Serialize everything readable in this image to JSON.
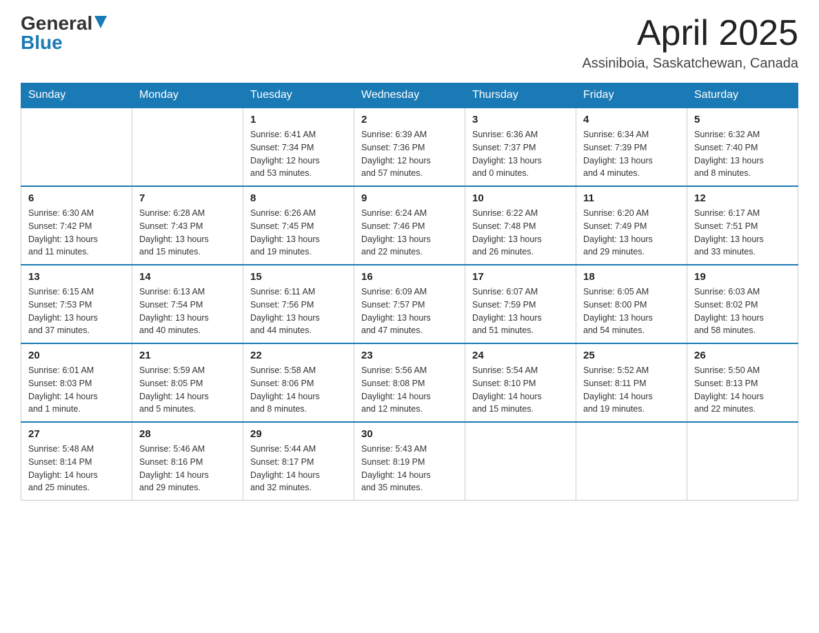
{
  "logo": {
    "general": "General",
    "blue": "Blue"
  },
  "title": "April 2025",
  "location": "Assiniboia, Saskatchewan, Canada",
  "weekdays": [
    "Sunday",
    "Monday",
    "Tuesday",
    "Wednesday",
    "Thursday",
    "Friday",
    "Saturday"
  ],
  "weeks": [
    [
      {
        "day": "",
        "info": ""
      },
      {
        "day": "",
        "info": ""
      },
      {
        "day": "1",
        "info": "Sunrise: 6:41 AM\nSunset: 7:34 PM\nDaylight: 12 hours\nand 53 minutes."
      },
      {
        "day": "2",
        "info": "Sunrise: 6:39 AM\nSunset: 7:36 PM\nDaylight: 12 hours\nand 57 minutes."
      },
      {
        "day": "3",
        "info": "Sunrise: 6:36 AM\nSunset: 7:37 PM\nDaylight: 13 hours\nand 0 minutes."
      },
      {
        "day": "4",
        "info": "Sunrise: 6:34 AM\nSunset: 7:39 PM\nDaylight: 13 hours\nand 4 minutes."
      },
      {
        "day": "5",
        "info": "Sunrise: 6:32 AM\nSunset: 7:40 PM\nDaylight: 13 hours\nand 8 minutes."
      }
    ],
    [
      {
        "day": "6",
        "info": "Sunrise: 6:30 AM\nSunset: 7:42 PM\nDaylight: 13 hours\nand 11 minutes."
      },
      {
        "day": "7",
        "info": "Sunrise: 6:28 AM\nSunset: 7:43 PM\nDaylight: 13 hours\nand 15 minutes."
      },
      {
        "day": "8",
        "info": "Sunrise: 6:26 AM\nSunset: 7:45 PM\nDaylight: 13 hours\nand 19 minutes."
      },
      {
        "day": "9",
        "info": "Sunrise: 6:24 AM\nSunset: 7:46 PM\nDaylight: 13 hours\nand 22 minutes."
      },
      {
        "day": "10",
        "info": "Sunrise: 6:22 AM\nSunset: 7:48 PM\nDaylight: 13 hours\nand 26 minutes."
      },
      {
        "day": "11",
        "info": "Sunrise: 6:20 AM\nSunset: 7:49 PM\nDaylight: 13 hours\nand 29 minutes."
      },
      {
        "day": "12",
        "info": "Sunrise: 6:17 AM\nSunset: 7:51 PM\nDaylight: 13 hours\nand 33 minutes."
      }
    ],
    [
      {
        "day": "13",
        "info": "Sunrise: 6:15 AM\nSunset: 7:53 PM\nDaylight: 13 hours\nand 37 minutes."
      },
      {
        "day": "14",
        "info": "Sunrise: 6:13 AM\nSunset: 7:54 PM\nDaylight: 13 hours\nand 40 minutes."
      },
      {
        "day": "15",
        "info": "Sunrise: 6:11 AM\nSunset: 7:56 PM\nDaylight: 13 hours\nand 44 minutes."
      },
      {
        "day": "16",
        "info": "Sunrise: 6:09 AM\nSunset: 7:57 PM\nDaylight: 13 hours\nand 47 minutes."
      },
      {
        "day": "17",
        "info": "Sunrise: 6:07 AM\nSunset: 7:59 PM\nDaylight: 13 hours\nand 51 minutes."
      },
      {
        "day": "18",
        "info": "Sunrise: 6:05 AM\nSunset: 8:00 PM\nDaylight: 13 hours\nand 54 minutes."
      },
      {
        "day": "19",
        "info": "Sunrise: 6:03 AM\nSunset: 8:02 PM\nDaylight: 13 hours\nand 58 minutes."
      }
    ],
    [
      {
        "day": "20",
        "info": "Sunrise: 6:01 AM\nSunset: 8:03 PM\nDaylight: 14 hours\nand 1 minute."
      },
      {
        "day": "21",
        "info": "Sunrise: 5:59 AM\nSunset: 8:05 PM\nDaylight: 14 hours\nand 5 minutes."
      },
      {
        "day": "22",
        "info": "Sunrise: 5:58 AM\nSunset: 8:06 PM\nDaylight: 14 hours\nand 8 minutes."
      },
      {
        "day": "23",
        "info": "Sunrise: 5:56 AM\nSunset: 8:08 PM\nDaylight: 14 hours\nand 12 minutes."
      },
      {
        "day": "24",
        "info": "Sunrise: 5:54 AM\nSunset: 8:10 PM\nDaylight: 14 hours\nand 15 minutes."
      },
      {
        "day": "25",
        "info": "Sunrise: 5:52 AM\nSunset: 8:11 PM\nDaylight: 14 hours\nand 19 minutes."
      },
      {
        "day": "26",
        "info": "Sunrise: 5:50 AM\nSunset: 8:13 PM\nDaylight: 14 hours\nand 22 minutes."
      }
    ],
    [
      {
        "day": "27",
        "info": "Sunrise: 5:48 AM\nSunset: 8:14 PM\nDaylight: 14 hours\nand 25 minutes."
      },
      {
        "day": "28",
        "info": "Sunrise: 5:46 AM\nSunset: 8:16 PM\nDaylight: 14 hours\nand 29 minutes."
      },
      {
        "day": "29",
        "info": "Sunrise: 5:44 AM\nSunset: 8:17 PM\nDaylight: 14 hours\nand 32 minutes."
      },
      {
        "day": "30",
        "info": "Sunrise: 5:43 AM\nSunset: 8:19 PM\nDaylight: 14 hours\nand 35 minutes."
      },
      {
        "day": "",
        "info": ""
      },
      {
        "day": "",
        "info": ""
      },
      {
        "day": "",
        "info": ""
      }
    ]
  ]
}
